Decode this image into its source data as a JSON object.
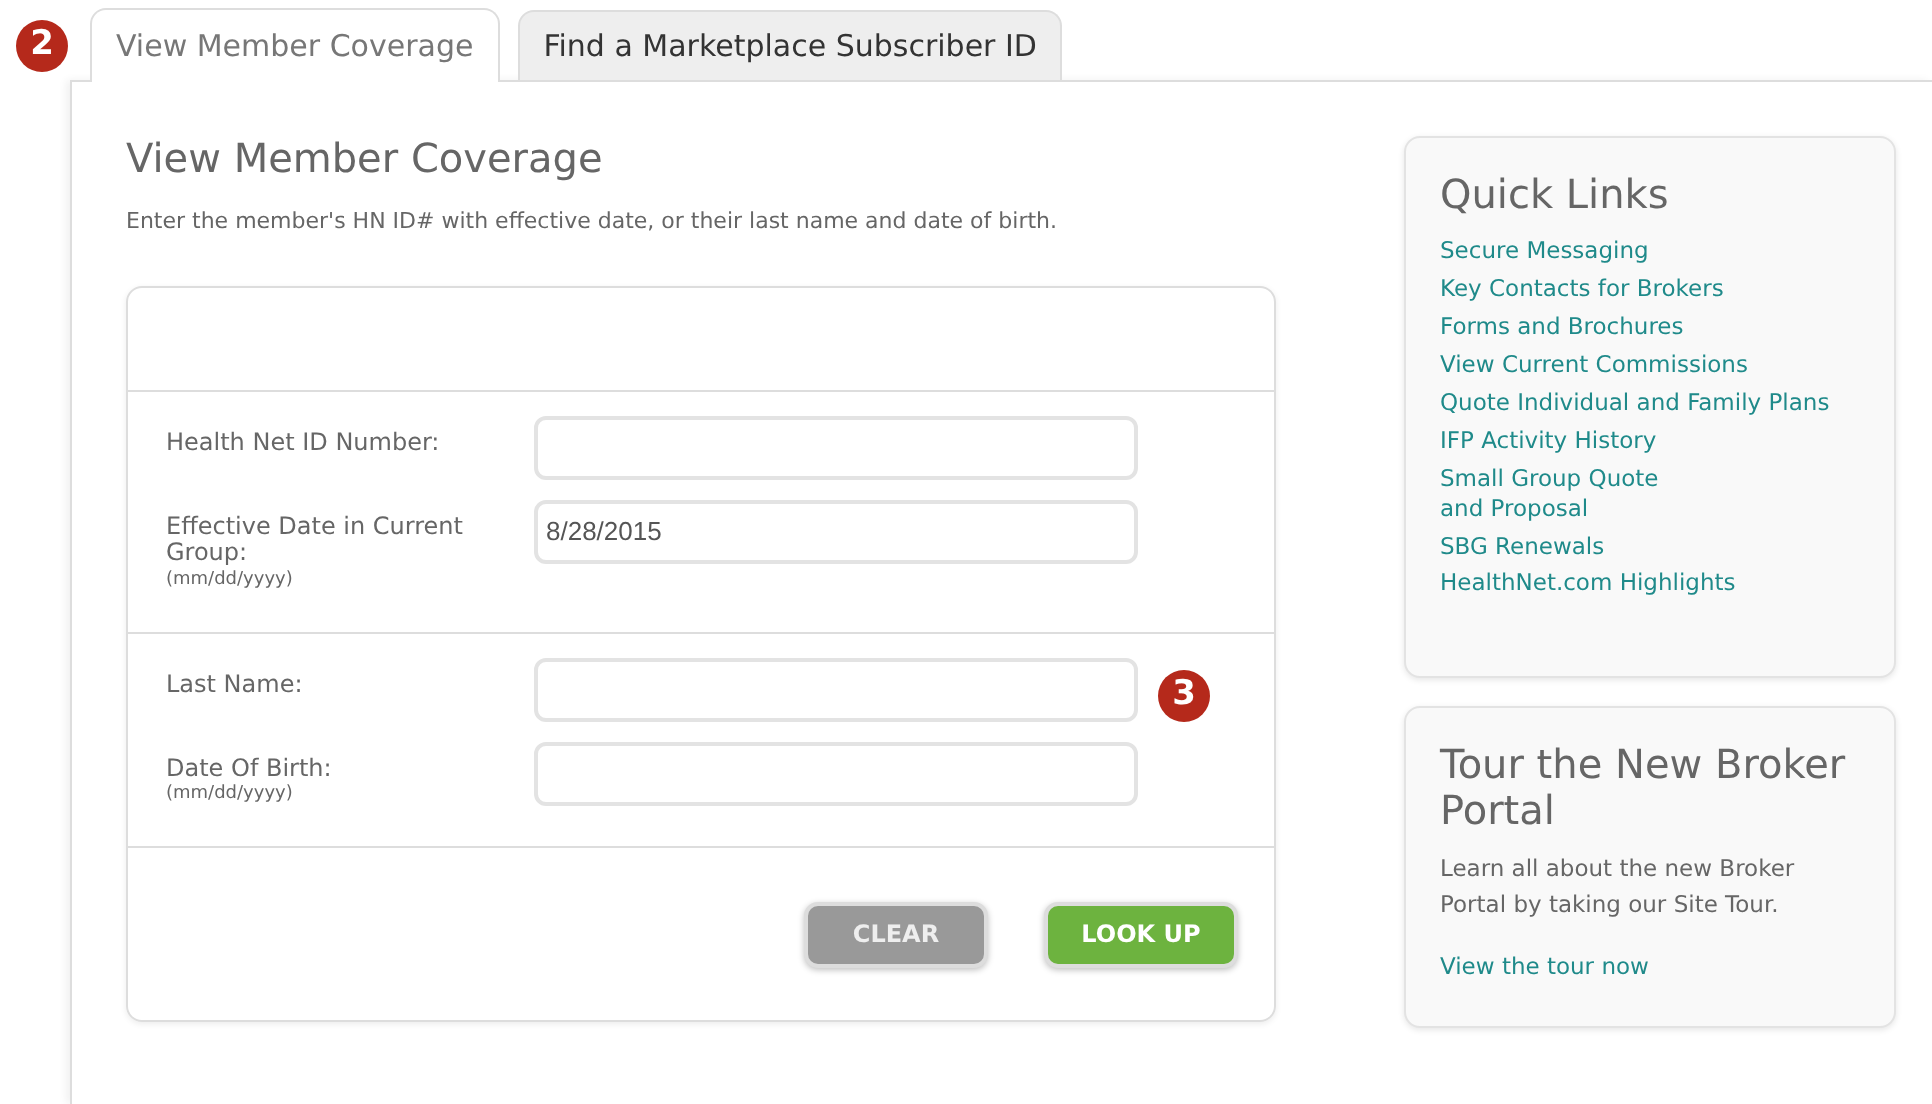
{
  "tab_callout": "2",
  "tabs": [
    {
      "label": "View Member Coverage",
      "selected": true
    },
    {
      "label": "Find a Marketplace Subscriber ID",
      "selected": false
    }
  ],
  "form": {
    "title": "View Member Coverage",
    "instruction": "Enter the member's HN ID# with effective date, or their last name and date of birth.",
    "sections": [
      {
        "fields": [
          {
            "label": "Health Net ID Number:"
          },
          {
            "label": "Effective Date in Current Group:",
            "hint": "(mm/dd/yyyy)",
            "value": "8/28/2015"
          }
        ]
      },
      {
        "fields": [
          {
            "label": "Last Name:",
            "callout": "3"
          },
          {
            "label": "Date Of Birth:",
            "hint": "(mm/dd/yyyy)"
          }
        ]
      }
    ],
    "buttons": [
      {
        "label": "CLEAR",
        "kind": "secondary"
      },
      {
        "label": "LOOK UP",
        "kind": "primary"
      }
    ]
  },
  "quick_links": {
    "title": "Quick Links",
    "links": [
      "Secure Messaging",
      "Key Contacts for Brokers",
      "Forms and Brochures",
      "View Current Commissions",
      "Quote Individual and Family Plans",
      "IFP Activity History",
      "Small Group Quote\nand Proposal",
      "SBG Renewals",
      "HealthNet.com Highlights"
    ]
  },
  "tour": {
    "title": "Tour the New Broker Portal",
    "text": "Learn all about the new Broker Portal by taking our Site Tour.",
    "link": "View the tour now"
  }
}
